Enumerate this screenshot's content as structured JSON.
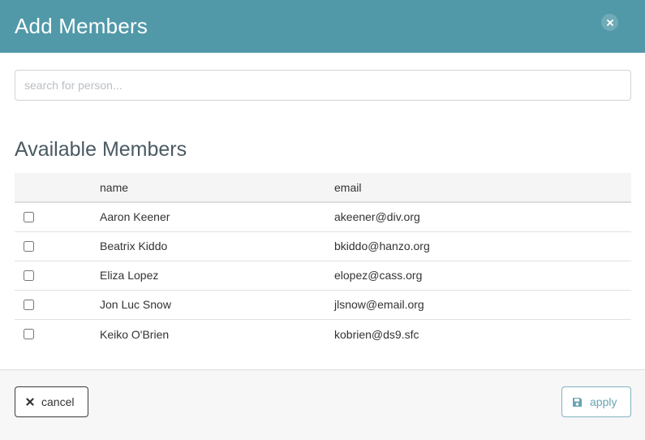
{
  "dialog": {
    "title": "Add Members",
    "close_icon": "close-icon"
  },
  "search": {
    "placeholder": "search for person...",
    "value": ""
  },
  "available": {
    "heading": "Available Members",
    "columns": {
      "name": "name",
      "email": "email"
    },
    "rows": [
      {
        "name": "Aaron Keener",
        "email": "akeener@div.org",
        "checked": false
      },
      {
        "name": "Beatrix Kiddo",
        "email": "bkiddo@hanzo.org",
        "checked": false
      },
      {
        "name": "Eliza Lopez",
        "email": "elopez@cass.org",
        "checked": false
      },
      {
        "name": "Jon Luc Snow",
        "email": "jlsnow@email.org",
        "checked": false
      },
      {
        "name": "Keiko O'Brien",
        "email": "kobrien@ds9.sfc",
        "checked": false
      }
    ]
  },
  "footer": {
    "cancel_label": "cancel",
    "cancel_icon": "x-icon",
    "apply_label": "apply",
    "apply_icon": "save-icon"
  },
  "colors": {
    "header_bg": "#5199a8",
    "apply_accent": "#6aa5b3"
  }
}
